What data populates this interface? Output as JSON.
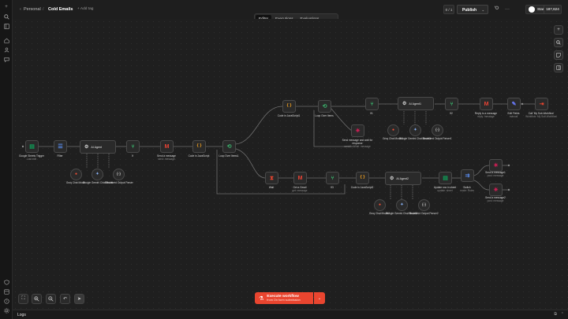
{
  "header": {
    "back_icon": "chevron-left-icon",
    "project": "Personal",
    "separator": "/",
    "workflow_name": "Cold Emails",
    "add_tag": "+ Add tag",
    "version_counter": "0 / 1",
    "publish_label": "Publish",
    "github_star_label": "Star",
    "github_star_count": "187,624"
  },
  "tabs": [
    "Editor",
    "Executions",
    "Evaluations"
  ],
  "canvas": {
    "nodes": [
      {
        "id": "trigger",
        "label": "Google Sheets Trigger",
        "sub": "Last edit",
        "icon": "sheets",
        "color": "#0f9d58"
      },
      {
        "id": "filter",
        "label": "Filter",
        "sub": "",
        "icon": "filter",
        "color": "#5b8def"
      },
      {
        "id": "agent1",
        "label": "AI Agent",
        "sub": "",
        "icon": "robot",
        "color": "#cfcfcf"
      },
      {
        "id": "if1",
        "label": "If",
        "sub": "",
        "icon": "if",
        "color": "#3bb56d"
      },
      {
        "id": "gmail1",
        "label": "Send a message",
        "sub": "send: message",
        "icon": "gmail",
        "color": "#ea4335"
      },
      {
        "id": "code1",
        "label": "Code in JavaScript",
        "sub": "",
        "icon": "code",
        "color": "#f0a020"
      },
      {
        "id": "loop1",
        "label": "Loop Over Items1",
        "sub": "",
        "icon": "loop",
        "color": "#3bb56d"
      },
      {
        "id": "code2",
        "label": "Code in JavaScript1",
        "sub": "",
        "icon": "code",
        "color": "#f0a020"
      },
      {
        "id": "loop2",
        "label": "Loop Over Items",
        "sub": "",
        "icon": "loop",
        "color": "#3bb56d"
      },
      {
        "id": "if2",
        "label": "If1",
        "sub": "",
        "icon": "if",
        "color": "#3bb56d"
      },
      {
        "id": "agent2",
        "label": "AI Agent1",
        "sub": "",
        "icon": "robot",
        "color": "#cfcfcf"
      },
      {
        "id": "if3",
        "label": "If2",
        "sub": "",
        "icon": "if",
        "color": "#3bb56d"
      },
      {
        "id": "gmail2",
        "label": "Reply to a message",
        "sub": "reply: message",
        "icon": "gmail",
        "color": "#ea4335"
      },
      {
        "id": "edit1",
        "label": "Edit Fields",
        "sub": "manual",
        "icon": "edit",
        "color": "#6b7cff"
      },
      {
        "id": "stopwf",
        "label": "Call 'My Sub-Workflow'",
        "sub": "Workflow: My Sub-Workflow",
        "icon": "exit",
        "color": "#e9452f"
      },
      {
        "id": "slackwait",
        "label": "Send message and wait for response",
        "sub": "sendAndWait: message",
        "icon": "slack",
        "color": "#e01e5a"
      },
      {
        "id": "wait1",
        "label": "Wait",
        "sub": "",
        "icon": "wait",
        "color": "#e9452f"
      },
      {
        "id": "gmail3",
        "label": "Get a Gmail",
        "sub": "get: message",
        "icon": "gmail",
        "color": "#ea4335"
      },
      {
        "id": "if4",
        "label": "If3",
        "sub": "",
        "icon": "if",
        "color": "#3bb56d"
      },
      {
        "id": "code3",
        "label": "Code in JavaScript2",
        "sub": "",
        "icon": "code",
        "color": "#f0a020"
      },
      {
        "id": "agent3",
        "label": "AI Agent2",
        "sub": "",
        "icon": "robot",
        "color": "#cfcfcf"
      },
      {
        "id": "sheets2",
        "label": "Update row in sheet",
        "sub": "update: sheet",
        "icon": "sheets",
        "color": "#0f9d58"
      },
      {
        "id": "switch1",
        "label": "Switch",
        "sub": "mode: Rules",
        "icon": "switch",
        "color": "#5b8def"
      },
      {
        "id": "slack1",
        "label": "Send a message1",
        "sub": "post: message",
        "icon": "slack",
        "color": "#e01e5a"
      },
      {
        "id": "slack2",
        "label": "Send a message2",
        "sub": "post: message",
        "icon": "slack",
        "color": "#e01e5a"
      }
    ],
    "subnodes": [
      {
        "id": "s1a",
        "label": "Groq Chat Model",
        "icon": "groq",
        "color": "#f55036"
      },
      {
        "id": "s1b",
        "label": "Google Gemini Chat Model",
        "icon": "gemini",
        "color": "#8ab4f8"
      },
      {
        "id": "s1c",
        "label": "Structured Output Parser",
        "icon": "braces",
        "color": "#cfcfcf"
      },
      {
        "id": "s2a",
        "label": "Groq Chat Model1",
        "icon": "groq",
        "color": "#f55036"
      },
      {
        "id": "s2b",
        "label": "Google Gemini Chat Model1",
        "icon": "gemini",
        "color": "#8ab4f8"
      },
      {
        "id": "s2c",
        "label": "Structured Output Parser1",
        "icon": "braces",
        "color": "#cfcfcf"
      },
      {
        "id": "s3a",
        "label": "Groq Chat Model2",
        "icon": "groq",
        "color": "#f55036"
      },
      {
        "id": "s3b",
        "label": "Google Gemini Chat Model2",
        "icon": "gemini",
        "color": "#8ab4f8"
      },
      {
        "id": "s3c",
        "label": "Structured Output Parser2",
        "icon": "braces",
        "color": "#cfcfcf"
      }
    ]
  },
  "execute": {
    "label": "Execute workflow",
    "sub": "from On form submission",
    "icon": "flask-icon"
  },
  "logs_label": "Logs",
  "accent": "#e9452f"
}
